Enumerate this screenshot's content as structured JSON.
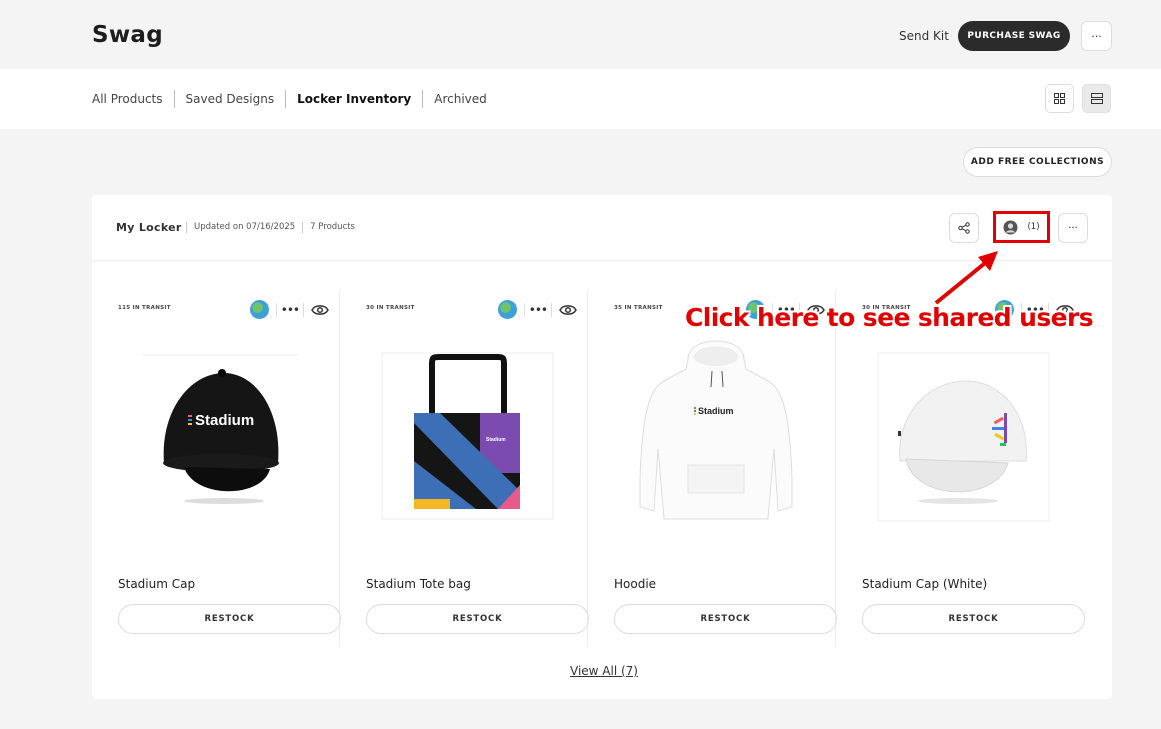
{
  "header": {
    "title": "Swag",
    "send_kit": "Send Kit",
    "purchase": "PURCHASE SWAG",
    "more": "···"
  },
  "tabs": [
    {
      "label": "All Products"
    },
    {
      "label": "Saved Designs"
    },
    {
      "label": "Locker Inventory",
      "active": true
    },
    {
      "label": "Archived"
    }
  ],
  "add_free_collections": "ADD FREE COLLECTIONS",
  "locker": {
    "name": "My Locker",
    "updated": "Updated on 07/16/2025",
    "products": "7 Products",
    "shared_users": "(1)",
    "more": "···"
  },
  "cards": [
    {
      "transit": "115 IN TRANSIT",
      "name": "Stadium Cap",
      "restock": "RESTOCK"
    },
    {
      "transit": "30 IN TRANSIT",
      "name": "Stadium Tote bag",
      "restock": "RESTOCK"
    },
    {
      "transit": "35 IN TRANSIT",
      "name": "Hoodie",
      "restock": "RESTOCK"
    },
    {
      "transit": "30 IN TRANSIT",
      "name": "Stadium Cap (White)",
      "restock": "RESTOCK"
    }
  ],
  "product_logo_text": "Stadium",
  "view_all": "View All (7)",
  "annotation": "Click here to see shared users",
  "colors": {
    "accent": "#2b2b2b",
    "highlight": "#e00000"
  }
}
